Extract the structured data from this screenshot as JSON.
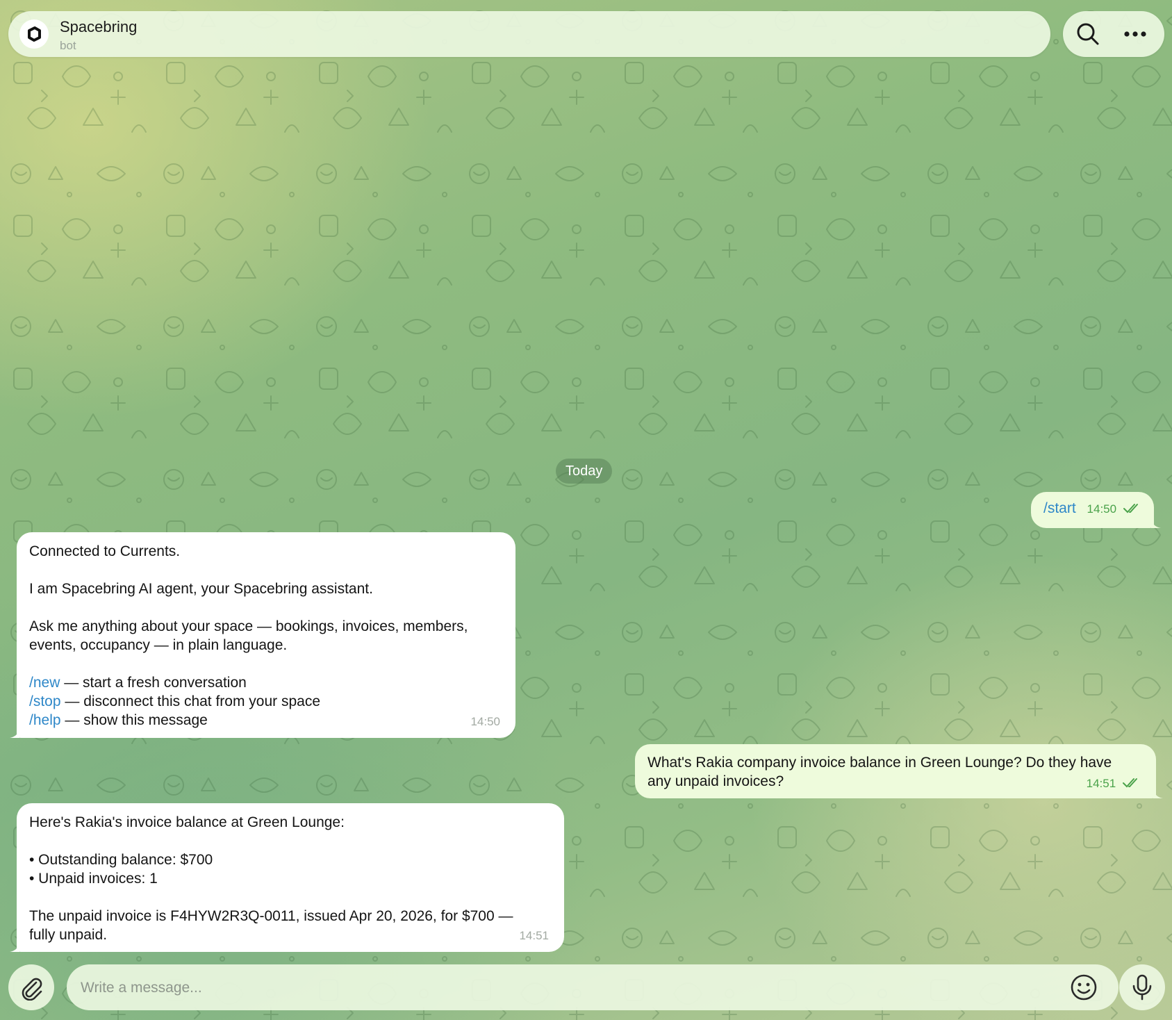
{
  "header": {
    "title": "Spacebring",
    "subtitle": "bot",
    "logo_icon": "spacebring-logo-icon",
    "search_icon": "search-icon",
    "more_icon": "more-dots-icon"
  },
  "date_divider": "Today",
  "messages": [
    {
      "direction": "out",
      "command": "/start",
      "time": "14:50",
      "status": "read"
    },
    {
      "direction": "in",
      "lines": {
        "l1": "Connected to Currents.",
        "l2": "I am Spacebring AI agent, your Spacebring assistant.",
        "l3": "Ask me anything about your space — bookings, invoices, members,",
        "l4": "events, occupancy — in plain language."
      },
      "commands": [
        {
          "cmd": "/new",
          "desc": " — start a fresh conversation"
        },
        {
          "cmd": "/stop",
          "desc": " — disconnect this chat from your space"
        },
        {
          "cmd": "/help",
          "desc": " — show this message"
        }
      ],
      "time": "14:50"
    },
    {
      "direction": "out",
      "lines": {
        "l1": "What's Rakia company invoice balance in Green Lounge? Do they have",
        "l2": "any unpaid invoices?"
      },
      "time": "14:51",
      "status": "read"
    },
    {
      "direction": "in",
      "lines": {
        "l1": "Here's Rakia's invoice balance at Green Lounge:",
        "l2": "• Outstanding balance: $700",
        "l3": "• Unpaid invoices: 1",
        "l4": "The unpaid invoice is F4HYW2R3Q-0011, issued Apr 20, 2026, for $700 —",
        "l5": "fully unpaid."
      },
      "time": "14:51"
    }
  ],
  "composer": {
    "placeholder": "Write a message...",
    "value": "",
    "attach_icon": "paperclip-icon",
    "emoji_icon": "emoji-icon",
    "mic_icon": "microphone-icon"
  },
  "colors": {
    "incoming_bubble": "#ffffff",
    "outgoing_bubble": "#eefbdc",
    "command_link": "#2e87c8",
    "outgoing_time": "#4aa24a"
  }
}
